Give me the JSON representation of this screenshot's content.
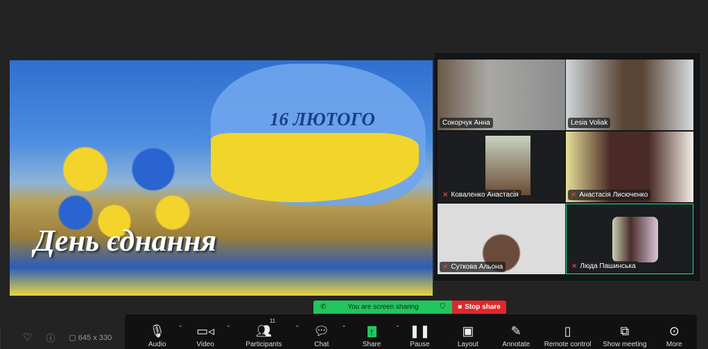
{
  "slide": {
    "date": "16 ЛЮТОГО",
    "title": "День єднання"
  },
  "participants": [
    {
      "name": "Сокорчук Анна",
      "muted": false
    },
    {
      "name": "Lesia Voliak",
      "muted": false
    },
    {
      "name": "Коваленко Анастасія",
      "muted": true
    },
    {
      "name": "Анастасія Лисюченко",
      "muted": true
    },
    {
      "name": "Суткова Альона",
      "muted": true
    },
    {
      "name": "Люда Пашинська",
      "muted": true
    }
  ],
  "sharing": {
    "status": "You are screen sharing",
    "stop": "Stop share"
  },
  "status": {
    "resolution": "645 x 330"
  },
  "toolbar": {
    "audio": "Audio",
    "video": "Video",
    "participants": "Participants",
    "participants_count": "11",
    "chat": "Chat",
    "share": "Share",
    "pause": "Pause",
    "layout": "Layout",
    "annotate": "Annotate",
    "remote": "Remote control",
    "show": "Show meeting",
    "more": "More"
  },
  "colors": {
    "share_green": "#22c55e",
    "stop_red": "#e0282a",
    "active_speaker": "#22e39a"
  }
}
